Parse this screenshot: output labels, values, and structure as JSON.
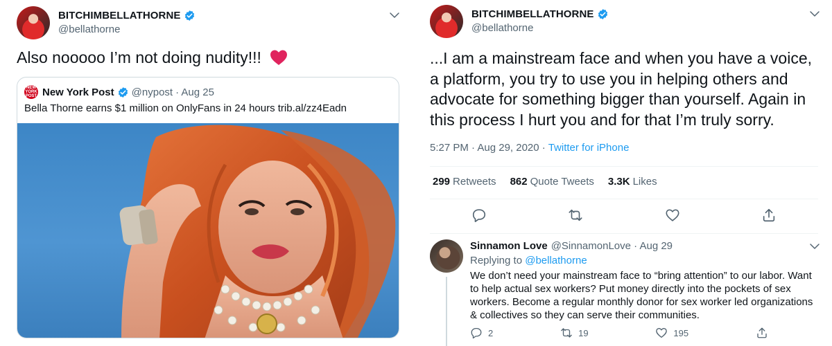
{
  "left_tweet": {
    "author_name": "BITCHIMBELLATHORNE",
    "author_handle": "@bellathorne",
    "text": "Also nooooo I’m not doing nudity!!!",
    "quote": {
      "logo_text": "NEW YORK POST",
      "author_name": "New York Post",
      "author_handle": "@nypost",
      "date": "· Aug 25",
      "text": "Bella Thorne earns $1 million on OnlyFans in 24 hours trib.al/zz4Eadn"
    }
  },
  "right_tweet": {
    "author_name": "BITCHIMBELLATHORNE",
    "author_handle": "@bellathorne",
    "text": "...I am a mainstream face and when you have a voice, a platform, you try to use you in helping others and advocate for something bigger than yourself. Again in this process I hurt you and for that I’m truly sorry.",
    "time": "5:27 PM · Aug 29, 2020 ·",
    "source": "Twitter for iPhone",
    "stats": {
      "retweets_count": "299",
      "retweets_label": "Retweets",
      "quotes_count": "862",
      "quotes_label": "Quote Tweets",
      "likes_count": "3.3K",
      "likes_label": "Likes"
    }
  },
  "reply": {
    "author_name": "Sinnamon Love",
    "author_handle": "@SinnamonLove · Aug 29",
    "replying_prefix": "Replying to",
    "replying_to": "@bellathorne",
    "text": "We don’t need your mainstream face to “bring attention” to our labor. Want to help actual sex workers? Put money directly into the pockets of sex workers. Become a regular monthly donor for sex worker led organizations & collectives so they can serve their communities.",
    "reply_count": "2",
    "retweet_count": "19",
    "like_count": "195"
  },
  "colors": {
    "accent": "#1d9bf0",
    "heart": "#e0245e",
    "secondary_text": "#536471",
    "nypost_red": "#d0021b"
  },
  "icons": [
    "verified-badge-icon",
    "chevron-down-icon",
    "reply-icon",
    "retweet-icon",
    "like-icon",
    "share-icon",
    "heart-emoji-icon"
  ]
}
